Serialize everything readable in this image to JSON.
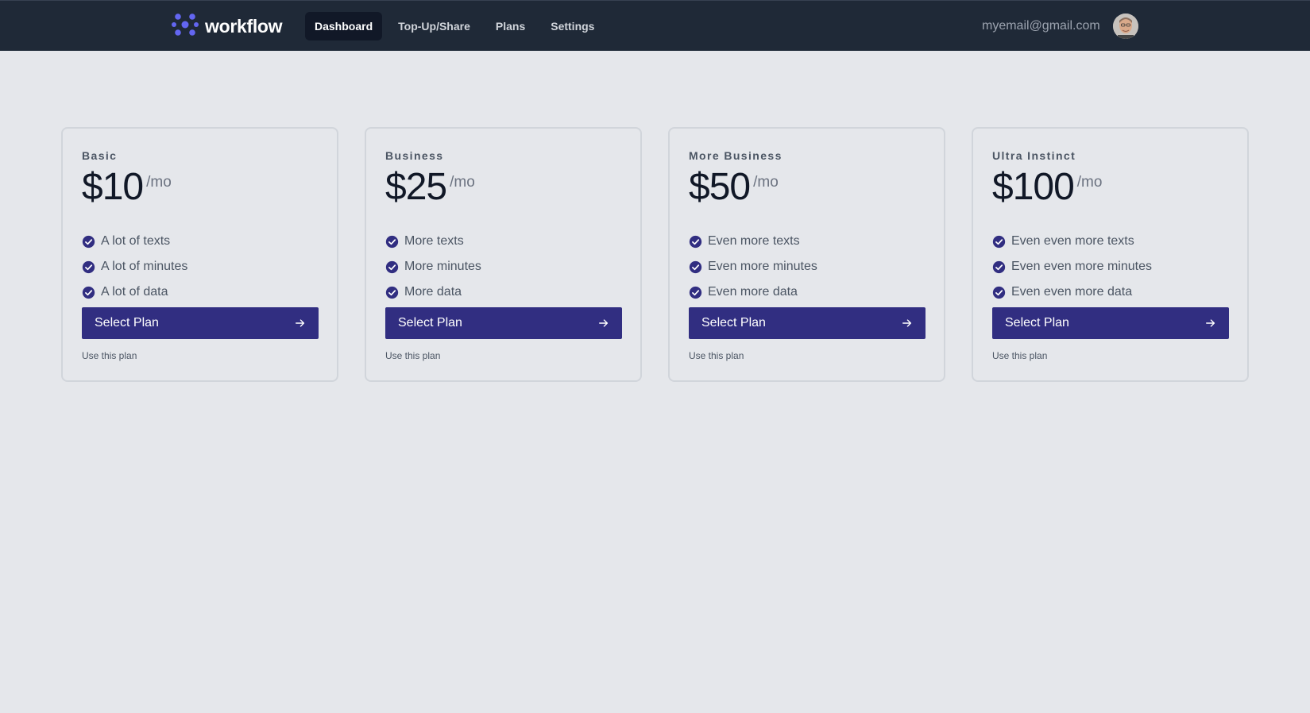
{
  "header": {
    "brand": "workflow",
    "nav": [
      {
        "label": "Dashboard",
        "active": true
      },
      {
        "label": "Top-Up/Share",
        "active": false
      },
      {
        "label": "Plans",
        "active": false
      },
      {
        "label": "Settings",
        "active": false
      }
    ],
    "user_email": "myemail@gmail.com",
    "logo_icon": "workflow-logo-icon",
    "avatar_icon": "user-avatar"
  },
  "plans": [
    {
      "name": "Basic",
      "price": "$10",
      "period": "/mo",
      "features": [
        "A lot of texts",
        "A lot of minutes",
        "A lot of data"
      ],
      "button": "Select Plan",
      "hint": "Use this plan"
    },
    {
      "name": "Business",
      "price": "$25",
      "period": "/mo",
      "features": [
        "More texts",
        "More minutes",
        "More data"
      ],
      "button": "Select Plan",
      "hint": "Use this plan"
    },
    {
      "name": "More Business",
      "price": "$50",
      "period": "/mo",
      "features": [
        "Even more texts",
        "Even more minutes",
        "Even more data"
      ],
      "button": "Select Plan",
      "hint": "Use this plan"
    },
    {
      "name": "Ultra Instinct",
      "price": "$100",
      "period": "/mo",
      "features": [
        "Even even more texts",
        "Even even more minutes",
        "Even even more data"
      ],
      "button": "Select Plan",
      "hint": "Use this plan"
    }
  ],
  "colors": {
    "topbar": "#1f2937",
    "accent": "#312e81",
    "logo": "#6366f1",
    "background": "#e5e7eb"
  }
}
